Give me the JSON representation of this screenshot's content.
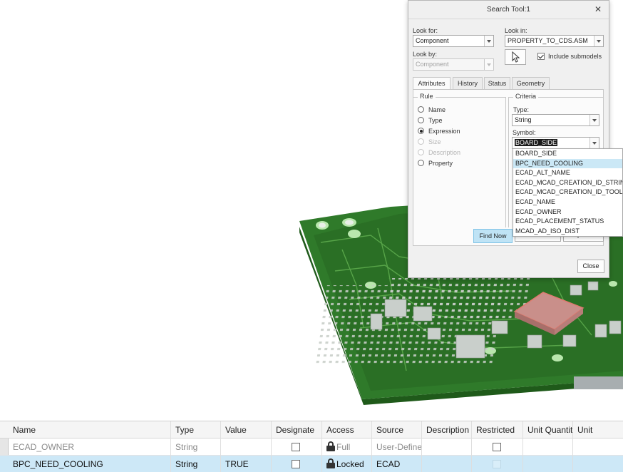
{
  "dialog": {
    "title": "Search Tool:1",
    "look_for_label": "Look for:",
    "look_for_value": "Component",
    "look_in_label": "Look in:",
    "look_in_value": "PROPERTY_TO_CDS.ASM",
    "look_by_label": "Look by:",
    "look_by_value": "Component",
    "include_submodels_label": "Include submodels",
    "include_submodels_checked": true,
    "tabs": [
      "Attributes",
      "History",
      "Status",
      "Geometry"
    ],
    "active_tab": "Attributes",
    "rule": {
      "title": "Rule",
      "options": [
        {
          "label": "Name",
          "enabled": true,
          "selected": false
        },
        {
          "label": "Type",
          "enabled": true,
          "selected": false
        },
        {
          "label": "Expression",
          "enabled": true,
          "selected": true
        },
        {
          "label": "Size",
          "enabled": false,
          "selected": false
        },
        {
          "label": "Description",
          "enabled": false,
          "selected": false
        },
        {
          "label": "Property",
          "enabled": true,
          "selected": false
        }
      ]
    },
    "criteria": {
      "title": "Criteria",
      "type_label": "Type:",
      "type_value": "String",
      "symbol_label": "Symbol:",
      "symbol_value": "BOARD_SIDE",
      "symbol_options": [
        "BOARD_SIDE",
        "BPC_NEED_COOLING",
        "ECAD_ALT_NAME",
        "ECAD_MCAD_CREATION_ID_STRING",
        "ECAD_MCAD_CREATION_ID_TOOL",
        "ECAD_NAME",
        "ECAD_OWNER",
        "ECAD_PLACEMENT_STATUS",
        "MCAD_AD_ISO_DIST"
      ],
      "highlighted_option": "BPC_NEED_COOLING"
    },
    "find_now_label": "Find Now",
    "new_search_label": "New Search",
    "options_label": "Options",
    "close_label": "Close"
  },
  "table": {
    "columns": [
      "Name",
      "Type",
      "Value",
      "Designate",
      "Access",
      "Source",
      "Description",
      "Restricted",
      "Unit Quantity",
      "Unit"
    ],
    "rows": [
      {
        "name": "ECAD_OWNER",
        "type": "String",
        "value": "",
        "designate": false,
        "access": "Full",
        "source": "User-Defined",
        "description": "",
        "restricted": false,
        "unit_quantity": "",
        "unit": ""
      },
      {
        "name": "BPC_NEED_COOLING",
        "type": "String",
        "value": "TRUE",
        "designate": false,
        "access": "Locked",
        "source": "ECAD",
        "description": "",
        "restricted": false,
        "unit_quantity": "",
        "unit": ""
      }
    ],
    "selected_row": 1
  },
  "colors": {
    "accent": "#cde8f7",
    "pcb_green": "#2f7a2a",
    "dialog_bg": "#f0f0f0"
  }
}
